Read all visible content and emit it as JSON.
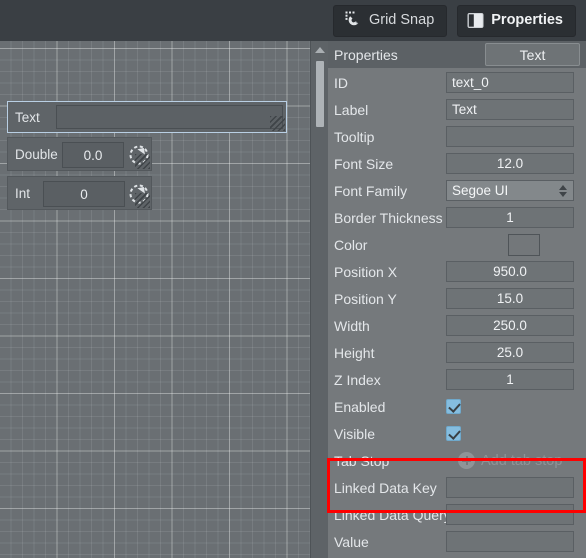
{
  "toolbar": {
    "grid_snap_label": "Grid Snap",
    "properties_label": "Properties",
    "grid_snap_icon": "magnet-icon",
    "properties_icon": "panel-icon"
  },
  "canvas": {
    "widgets": [
      {
        "label": "Text",
        "value": "",
        "selected": true,
        "has_dial": false
      },
      {
        "label": "Double",
        "value": "0.0",
        "selected": false,
        "has_dial": true
      },
      {
        "label": "Int",
        "value": "0",
        "selected": false,
        "has_dial": true
      }
    ],
    "scrollbar": {
      "arrow": "arrow-up-icon"
    }
  },
  "properties": {
    "header_title": "Properties",
    "tab_label": "Text",
    "rows": [
      {
        "label": "ID",
        "type": "text",
        "value": "text_0",
        "align": "left"
      },
      {
        "label": "Label",
        "type": "text",
        "value": "Text",
        "align": "left"
      },
      {
        "label": "Tooltip",
        "type": "text",
        "value": "",
        "align": "left"
      },
      {
        "label": "Font Size",
        "type": "text",
        "value": "12.0",
        "align": "center"
      },
      {
        "label": "Font Family",
        "type": "select",
        "value": "Segoe UI",
        "align": "left"
      },
      {
        "label": "Border Thickness",
        "type": "text",
        "value": "1",
        "align": "center"
      },
      {
        "label": "Color",
        "type": "color",
        "value": "",
        "align": "left"
      },
      {
        "label": "Position X",
        "type": "text",
        "value": "950.0",
        "align": "center"
      },
      {
        "label": "Position Y",
        "type": "text",
        "value": "15.0",
        "align": "center"
      },
      {
        "label": "Width",
        "type": "text",
        "value": "250.0",
        "align": "center"
      },
      {
        "label": "Height",
        "type": "text",
        "value": "25.0",
        "align": "center"
      },
      {
        "label": "Z Index",
        "type": "text",
        "value": "1",
        "align": "center"
      },
      {
        "label": "Enabled",
        "type": "checkbox",
        "value": "checked",
        "align": "left"
      },
      {
        "label": "Visible",
        "type": "checkbox",
        "value": "checked",
        "align": "left"
      },
      {
        "label": "Tab Stop",
        "type": "action",
        "value": "Add tab stop",
        "align": "left"
      },
      {
        "label": "Linked Data Key",
        "type": "text",
        "value": "",
        "align": "left"
      },
      {
        "label": "Linked Data Query",
        "type": "text",
        "value": "",
        "align": "left"
      },
      {
        "label": "Value",
        "type": "text",
        "value": "",
        "align": "left"
      }
    ],
    "highlight_color": "#fe0000",
    "add_tab_stop_icon": "plus-circle-icon"
  },
  "colors": {
    "toolbar_bg": "#3a3f44",
    "canvas_bg": "#6a6f73",
    "panel_bg": "#75797c",
    "panel_header_bg": "#5c6165",
    "field_bg": "#6e7376",
    "checkbox_accent": "#85bddf",
    "selection_border": "#b9cfe4",
    "highlight": "#fe0000"
  }
}
